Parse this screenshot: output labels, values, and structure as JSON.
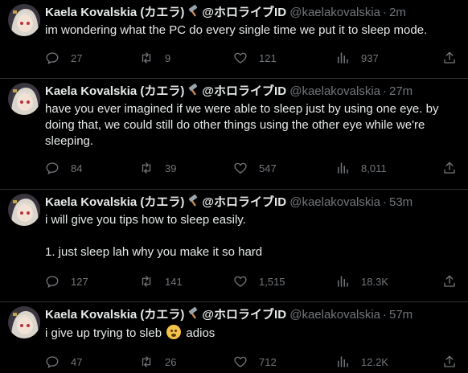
{
  "author": {
    "name": "Kaela Kovalskia (カエラ)",
    "agency": "@ホロライブID",
    "handle": "@kaelakovalskia"
  },
  "tweets": [
    {
      "time": "2m",
      "text": "im wondering what the PC do every single time we put it to sleep mode.",
      "replies": "27",
      "retweets": "9",
      "likes": "121",
      "views": "937"
    },
    {
      "time": "27m",
      "text": "have you ever imagined if we were able to sleep just by using one eye. by doing that, we could still do other things using the other eye while we're sleeping.",
      "replies": "84",
      "retweets": "39",
      "likes": "547",
      "views": "8,011"
    },
    {
      "time": "53m",
      "text_line1": "i will give you tips how to sleep easily.",
      "text_line2": "1. just sleep lah why you make it so hard",
      "replies": "127",
      "retweets": "141",
      "likes": "1,515",
      "views": "18.3K"
    },
    {
      "time": "57m",
      "text_before": "i give up trying to sleb",
      "text_after": "adios",
      "emoji": "yawning-face-icon",
      "replies": "47",
      "retweets": "26",
      "likes": "712",
      "views": "12.2K"
    }
  ],
  "colors": {
    "background": "#000000",
    "text": "#e7e9ea",
    "muted": "#71767b",
    "divider": "#2f3336"
  }
}
